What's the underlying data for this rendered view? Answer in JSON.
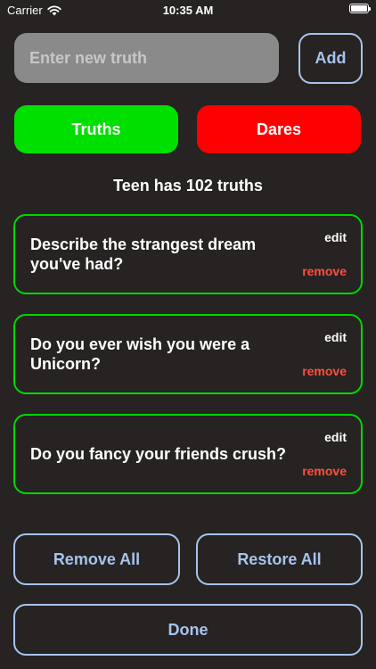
{
  "status_bar": {
    "carrier": "Carrier",
    "time": "10:35 AM"
  },
  "new_truth": {
    "placeholder": "Enter new truth",
    "value": "",
    "add_label": "Add"
  },
  "tabs": [
    {
      "label": "Truths",
      "color": "#00e000",
      "selected": true
    },
    {
      "label": "Dares",
      "color": "#ff0000",
      "selected": false
    }
  ],
  "count_text": "Teen has 102 truths",
  "cards": [
    {
      "text": "Describe the strangest dream you've had?",
      "edit": "edit",
      "remove": "remove"
    },
    {
      "text": "Do you ever wish you were a Unicorn?",
      "edit": "edit",
      "remove": "remove"
    },
    {
      "text": "Do you fancy your friends crush?",
      "edit": "edit",
      "remove": "remove"
    }
  ],
  "actions": {
    "remove_all": "Remove All",
    "restore_all": "Restore All",
    "done": "Done"
  },
  "colors": {
    "background": "#262322",
    "accent": "#a7c3ec",
    "card_border": "#00d800",
    "remove": "#ff4f3f"
  }
}
